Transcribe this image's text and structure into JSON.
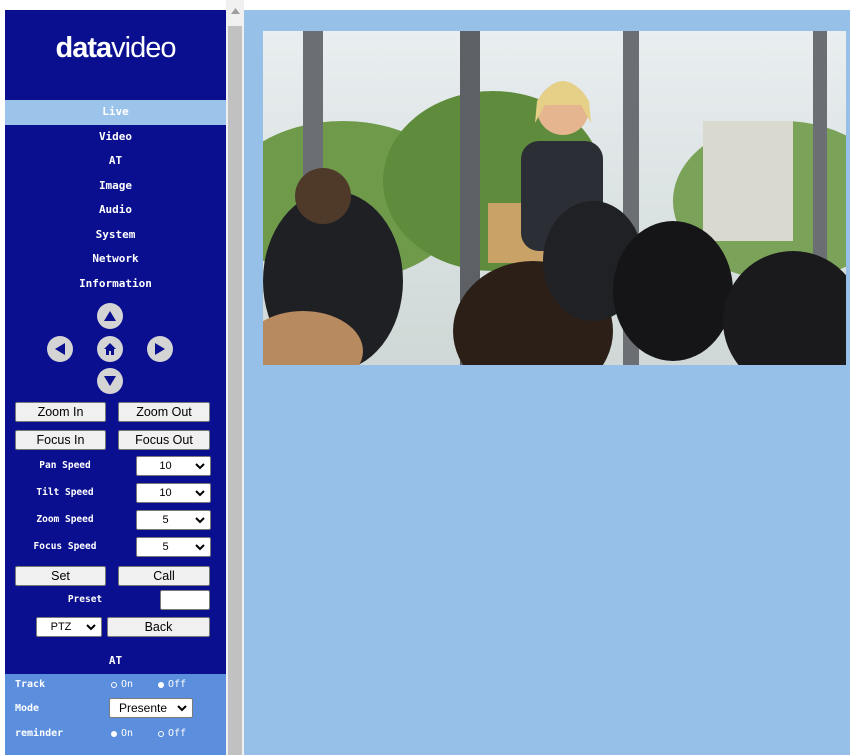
{
  "sidebar": {
    "logo": {
      "bold": "data",
      "thin": "video"
    },
    "menu": [
      {
        "label": "Live",
        "active": true
      },
      {
        "label": "Video"
      },
      {
        "label": "AT"
      },
      {
        "label": "Image"
      },
      {
        "label": "Audio"
      },
      {
        "label": "System"
      },
      {
        "label": "Network"
      },
      {
        "label": "Information"
      }
    ],
    "ptz_buttons": {
      "zoom_in": "Zoom In",
      "zoom_out": "Zoom Out",
      "focus_in": "Focus In",
      "focus_out": "Focus Out"
    },
    "speeds": {
      "pan": {
        "label": "Pan Speed",
        "value": "10"
      },
      "tilt": {
        "label": "Tilt Speed",
        "value": "10"
      },
      "zoom": {
        "label": "Zoom Speed",
        "value": "5"
      },
      "focus": {
        "label": "Focus Speed",
        "value": "5"
      }
    },
    "preset": {
      "set_label": "Set",
      "call_label": "Call",
      "label": "Preset",
      "value": ""
    },
    "mode_select": {
      "value": "PTZ"
    },
    "back_label": "Back"
  },
  "at": {
    "title": "AT",
    "track": {
      "label": "Track",
      "on": "On",
      "off": "Off",
      "selected": "off"
    },
    "mode": {
      "label": "Mode",
      "value": "Presente"
    },
    "reminder": {
      "label": "reminder",
      "on": "On",
      "off": "Off",
      "selected": "on"
    }
  },
  "icons": {
    "up": "arrow-up-icon",
    "left": "arrow-left-icon",
    "home": "home-icon",
    "right": "arrow-right-icon",
    "down": "arrow-down-icon",
    "chevron": "chevron-down-icon"
  },
  "colors": {
    "sidebar_bg": "#0a0f90",
    "active_menu": "#9cc3ea",
    "at_panel": "#5b8fde",
    "main_bg": "#97c0e8"
  }
}
